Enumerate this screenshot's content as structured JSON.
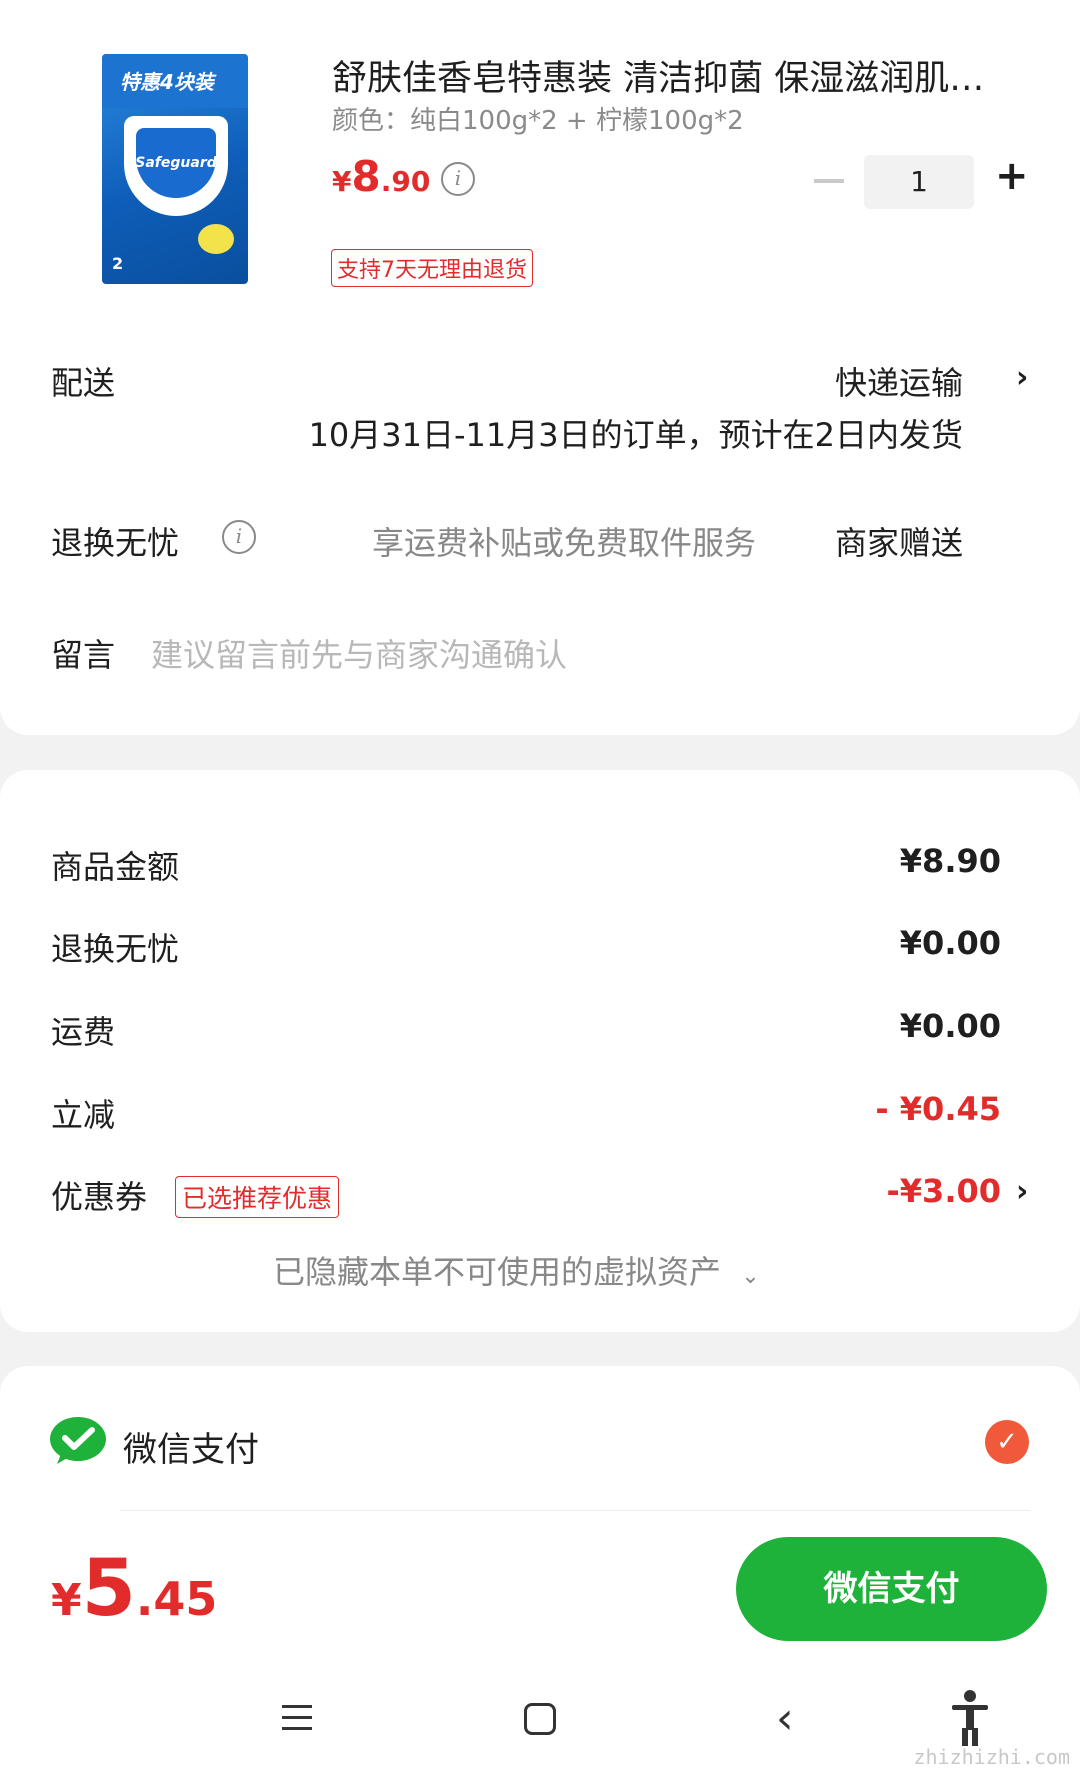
{
  "product": {
    "title": "舒肤佳香皂特惠装 清洁抑菌 保湿滋润肌…",
    "spec": "颜色：纯白100g*2 + 柠檬100g*2",
    "price_symbol": "¥",
    "price_int": "8",
    "price_dec": ".90",
    "return_tag": "支持7天无理由退货",
    "quantity": "1",
    "image_band_text": "特惠4块装",
    "image_logo_text": "Safeguard",
    "image_count_text": "2"
  },
  "delivery": {
    "label": "配送",
    "method": "快递运输",
    "note": "10月31日-11月3日的订单，预计在2日内发货"
  },
  "return_service": {
    "label": "退换无忧",
    "desc": "享运费补贴或免费取件服务",
    "provider": "商家赠送"
  },
  "message": {
    "label": "留言",
    "placeholder": "建议留言前先与商家沟通确认"
  },
  "fees": {
    "goods_label": "商品金额",
    "goods_value": "¥8.90",
    "return_label": "退换无忧",
    "return_value": "¥0.00",
    "shipping_label": "运费",
    "shipping_value": "¥0.00",
    "discount_label": "立减",
    "discount_value": "- ¥0.45",
    "coupon_label": "优惠券",
    "coupon_tag": "已选推荐优惠",
    "coupon_value": "-¥3.00",
    "hidden_assets": "已隐藏本单不可使用的虚拟资产"
  },
  "payment": {
    "method_label": "微信支付",
    "selected": true
  },
  "footer": {
    "total_symbol": "¥",
    "total_int": "5",
    "total_dec": ".45",
    "pay_button": "微信支付"
  },
  "watermark": "zhizhizhi.com",
  "colors": {
    "accent_red": "#e22c2c",
    "wechat_green": "#1fb23b",
    "check_orange": "#f05a3a"
  }
}
